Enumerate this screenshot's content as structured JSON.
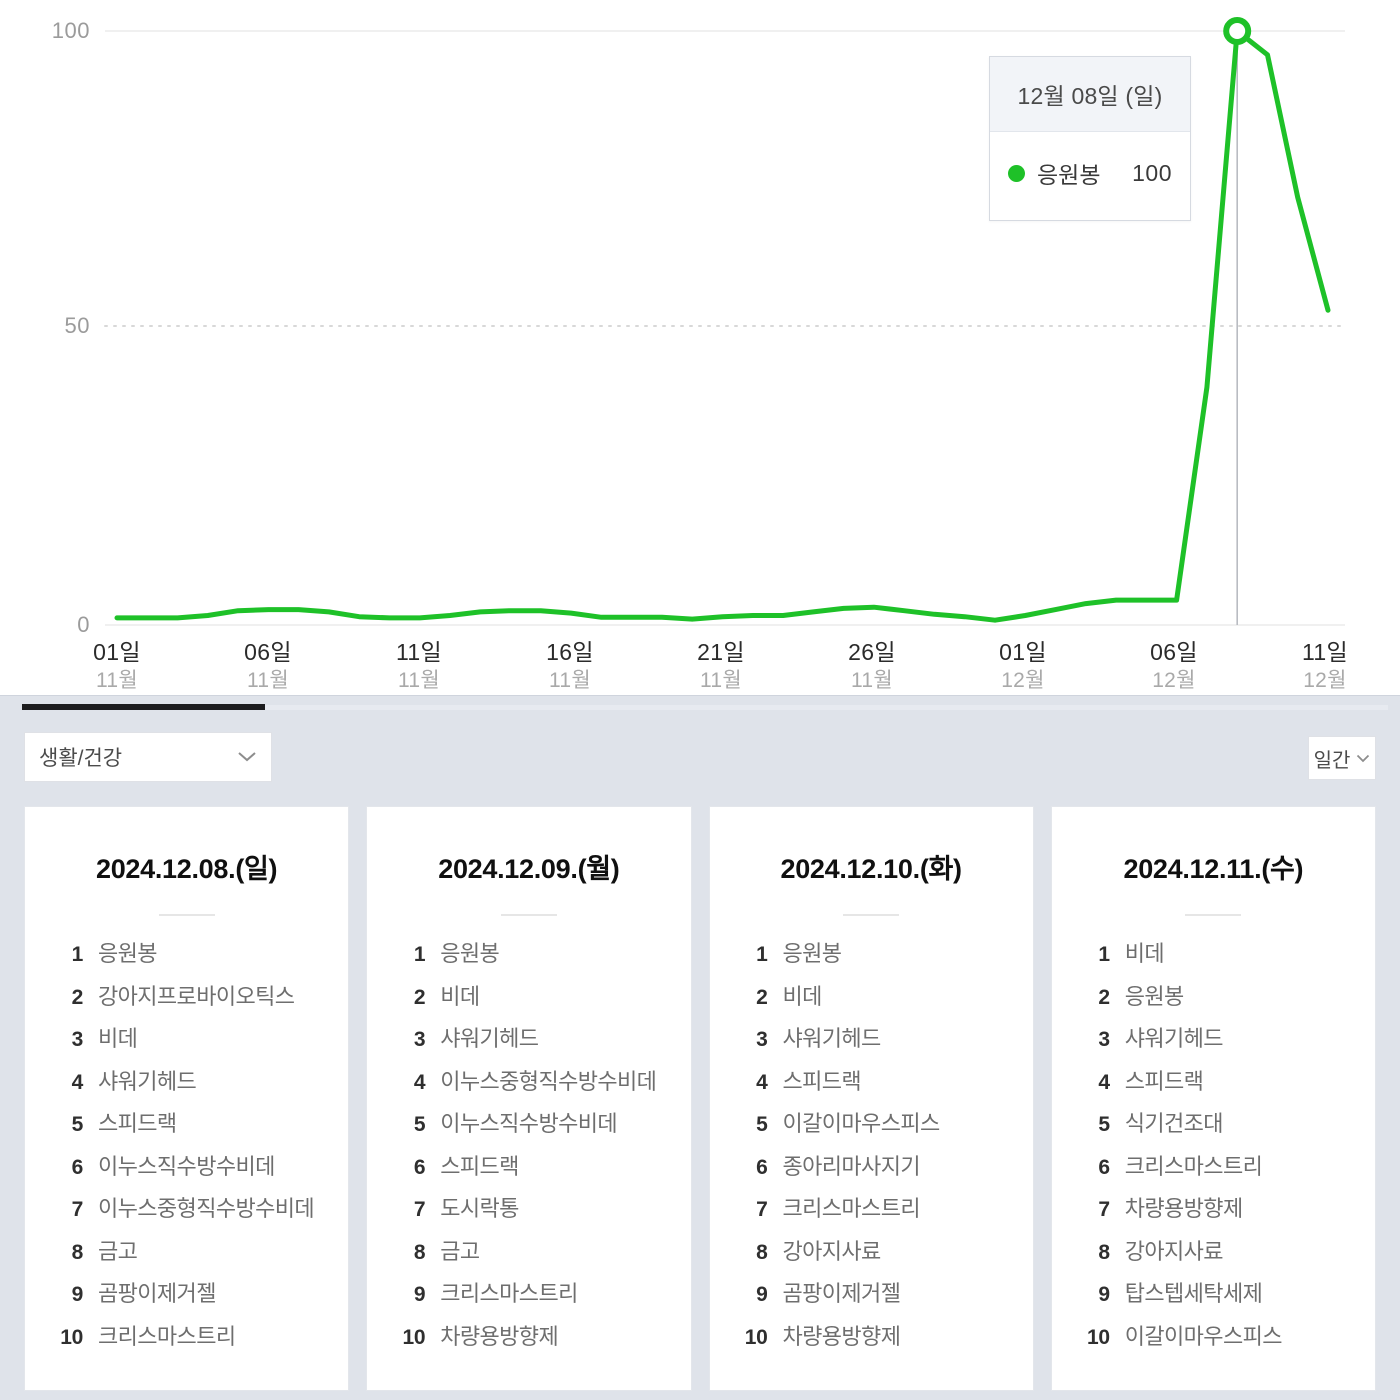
{
  "chart_data": {
    "type": "line",
    "title": "",
    "xlabel": "",
    "ylabel": "",
    "ylim": [
      0,
      100
    ],
    "yticks": [
      0,
      50,
      100
    ],
    "grid": "horizontal-dotted",
    "legend": [
      "응원봉"
    ],
    "series_color": "#1ec128",
    "x_tick_labels": [
      {
        "day": "01일",
        "month": "11월"
      },
      {
        "day": "06일",
        "month": "11월"
      },
      {
        "day": "11일",
        "month": "11월"
      },
      {
        "day": "16일",
        "month": "11월"
      },
      {
        "day": "21일",
        "month": "11월"
      },
      {
        "day": "26일",
        "month": "11월"
      },
      {
        "day": "01일",
        "month": "12월"
      },
      {
        "day": "06일",
        "month": "12월"
      },
      {
        "day": "11일",
        "month": "12월"
      }
    ],
    "series": [
      {
        "name": "응원봉",
        "x": [
          "11-01",
          "11-02",
          "11-03",
          "11-04",
          "11-05",
          "11-06",
          "11-07",
          "11-08",
          "11-09",
          "11-10",
          "11-11",
          "11-12",
          "11-13",
          "11-14",
          "11-15",
          "11-16",
          "11-17",
          "11-18",
          "11-19",
          "11-20",
          "11-21",
          "11-22",
          "11-23",
          "11-24",
          "11-25",
          "11-26",
          "11-27",
          "11-28",
          "11-29",
          "11-30",
          "12-01",
          "12-02",
          "12-03",
          "12-04",
          "12-05",
          "12-06",
          "12-07",
          "12-08",
          "12-09",
          "12-10",
          "12-11"
        ],
        "values": [
          1.2,
          1.2,
          1.2,
          1.6,
          2.4,
          2.6,
          2.6,
          2.2,
          1.4,
          1.2,
          1.2,
          1.6,
          2.2,
          2.4,
          2.4,
          2.0,
          1.3,
          1.3,
          1.3,
          1.0,
          1.4,
          1.6,
          1.6,
          2.2,
          2.8,
          3.0,
          2.4,
          1.8,
          1.4,
          0.8,
          1.6,
          2.6,
          3.6,
          4.2,
          4.2,
          4.2,
          40.0,
          100.0,
          96.0,
          72.0,
          53.0
        ]
      }
    ],
    "highlight": {
      "x": "12-08",
      "value": 100,
      "marker": "open-circle"
    },
    "tooltip": {
      "date": "12월 08일 (일)",
      "series_name": "응원봉",
      "value": "100",
      "dot_color": "#1ec128"
    }
  },
  "chart_axis": {
    "y_labels": [
      "100",
      "50",
      "0"
    ]
  },
  "lower_panel": {
    "category_select": {
      "value": "생활/건강",
      "icon": "chevron-down-icon"
    },
    "period_select": {
      "value": "일간",
      "icon": "chevron-down-icon"
    },
    "cards": [
      {
        "title": "2024.12.08.(일)",
        "items": [
          {
            "rank": "1",
            "name": "응원봉"
          },
          {
            "rank": "2",
            "name": "강아지프로바이오틱스"
          },
          {
            "rank": "3",
            "name": "비데"
          },
          {
            "rank": "4",
            "name": "샤워기헤드"
          },
          {
            "rank": "5",
            "name": "스피드랙"
          },
          {
            "rank": "6",
            "name": "이누스직수방수비데"
          },
          {
            "rank": "7",
            "name": "이누스중형직수방수비데"
          },
          {
            "rank": "8",
            "name": "금고"
          },
          {
            "rank": "9",
            "name": "곰팡이제거젤"
          },
          {
            "rank": "10",
            "name": "크리스마스트리"
          }
        ]
      },
      {
        "title": "2024.12.09.(월)",
        "items": [
          {
            "rank": "1",
            "name": "응원봉"
          },
          {
            "rank": "2",
            "name": "비데"
          },
          {
            "rank": "3",
            "name": "샤워기헤드"
          },
          {
            "rank": "4",
            "name": "이누스중형직수방수비데"
          },
          {
            "rank": "5",
            "name": "이누스직수방수비데"
          },
          {
            "rank": "6",
            "name": "스피드랙"
          },
          {
            "rank": "7",
            "name": "도시락통"
          },
          {
            "rank": "8",
            "name": "금고"
          },
          {
            "rank": "9",
            "name": "크리스마스트리"
          },
          {
            "rank": "10",
            "name": "차량용방향제"
          }
        ]
      },
      {
        "title": "2024.12.10.(화)",
        "items": [
          {
            "rank": "1",
            "name": "응원봉"
          },
          {
            "rank": "2",
            "name": "비데"
          },
          {
            "rank": "3",
            "name": "샤워기헤드"
          },
          {
            "rank": "4",
            "name": "스피드랙"
          },
          {
            "rank": "5",
            "name": "이갈이마우스피스"
          },
          {
            "rank": "6",
            "name": "종아리마사지기"
          },
          {
            "rank": "7",
            "name": "크리스마스트리"
          },
          {
            "rank": "8",
            "name": "강아지사료"
          },
          {
            "rank": "9",
            "name": "곰팡이제거젤"
          },
          {
            "rank": "10",
            "name": "차량용방향제"
          }
        ]
      },
      {
        "title": "2024.12.11.(수)",
        "items": [
          {
            "rank": "1",
            "name": "비데"
          },
          {
            "rank": "2",
            "name": "응원봉"
          },
          {
            "rank": "3",
            "name": "샤워기헤드"
          },
          {
            "rank": "4",
            "name": "스피드랙"
          },
          {
            "rank": "5",
            "name": "식기건조대"
          },
          {
            "rank": "6",
            "name": "크리스마스트리"
          },
          {
            "rank": "7",
            "name": "차량용방향제"
          },
          {
            "rank": "8",
            "name": "강아지사료"
          },
          {
            "rank": "9",
            "name": "탑스텝세탁세제"
          },
          {
            "rank": "10",
            "name": "이갈이마우스피스"
          }
        ]
      }
    ]
  }
}
